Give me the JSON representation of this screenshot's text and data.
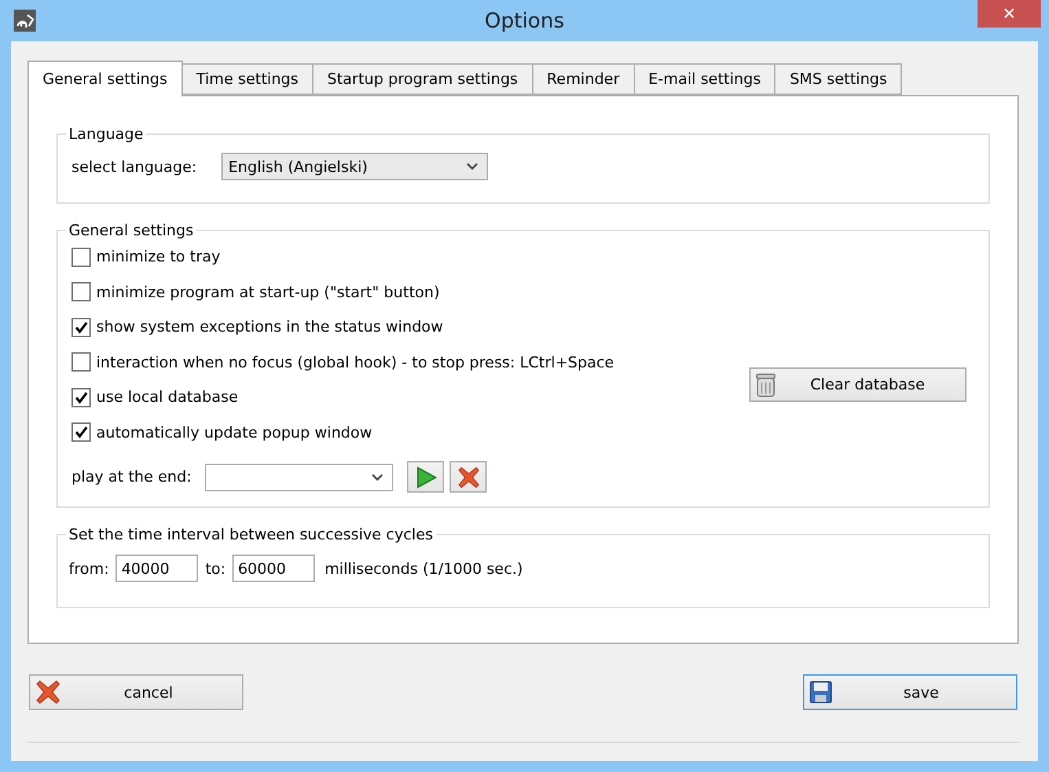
{
  "window": {
    "title": "Options",
    "close_label": "✕"
  },
  "tabs": [
    {
      "label": "General settings",
      "selected": true
    },
    {
      "label": "Time settings",
      "selected": false
    },
    {
      "label": "Startup program settings",
      "selected": false
    },
    {
      "label": "Reminder",
      "selected": false
    },
    {
      "label": "E-mail settings",
      "selected": false
    },
    {
      "label": "SMS settings",
      "selected": false
    }
  ],
  "language": {
    "legend": "Language",
    "label": "select language:",
    "value": "English (Angielski)"
  },
  "general": {
    "legend": "General settings",
    "options": [
      {
        "label": "minimize to tray",
        "checked": false
      },
      {
        "label": "minimize program at start-up (\"start\" button)",
        "checked": false
      },
      {
        "label": "show system exceptions in the status window",
        "checked": true
      },
      {
        "label": "interaction when no focus (global hook) - to stop press: LCtrl+Space",
        "checked": false
      },
      {
        "label": "use local database",
        "checked": true
      },
      {
        "label": "automatically update popup window",
        "checked": true
      }
    ],
    "play_label": "play at the end:",
    "clear_button": "Clear database"
  },
  "interval": {
    "legend": "Set the time interval between successive cycles",
    "from_label": "from:",
    "from": "40000",
    "to_label": "to:",
    "to": "60000",
    "unit": "milliseconds (1/1000 sec.)"
  },
  "buttons": {
    "cancel": "cancel",
    "save": "save"
  }
}
